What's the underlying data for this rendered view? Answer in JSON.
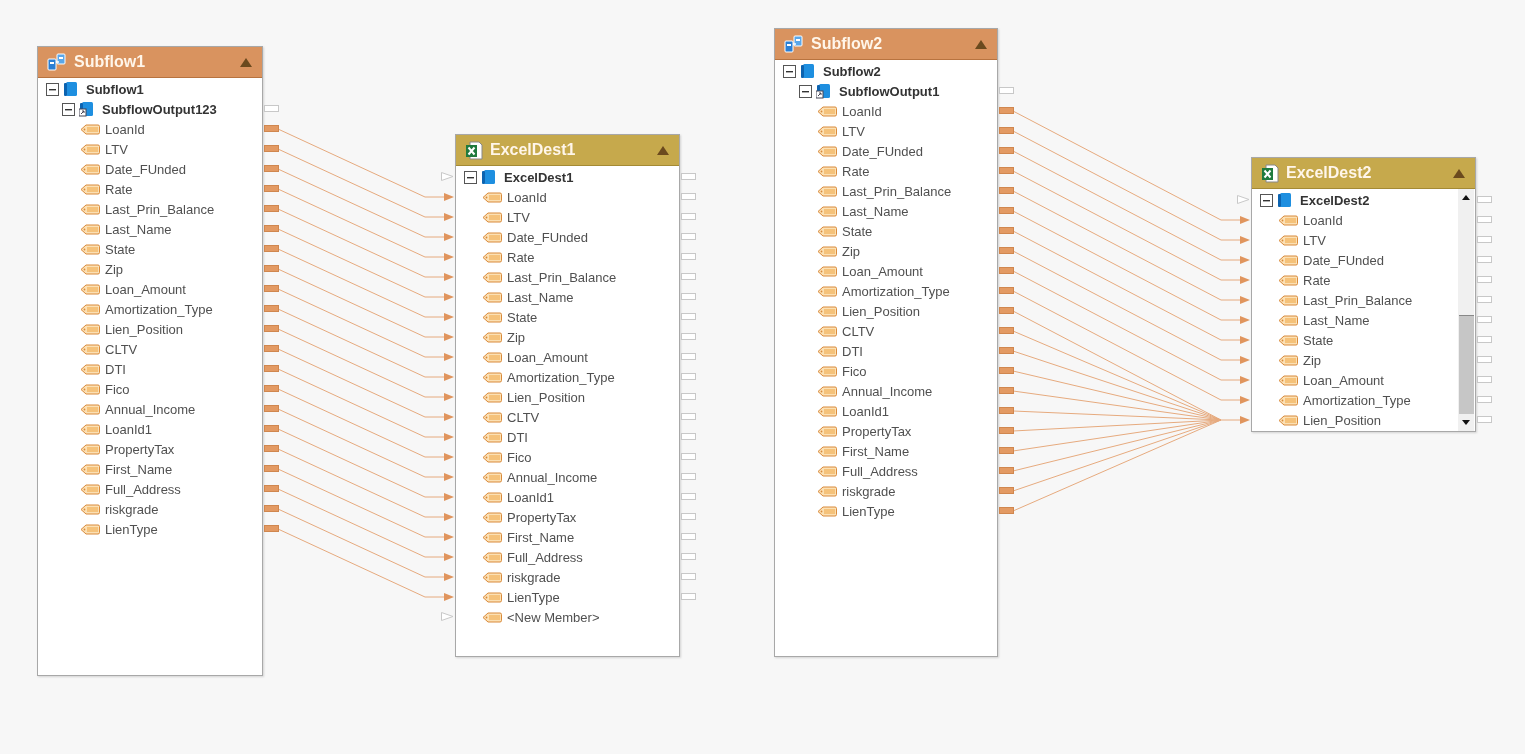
{
  "nodes": [
    {
      "kind": "subflow",
      "title": "Subflow1",
      "root": {
        "label": "Subflow1",
        "expanded": true
      },
      "output": {
        "label": "SubflowOutput123",
        "expanded": true
      },
      "fields": [
        {
          "label": "LoanId",
          "connected": true
        },
        {
          "label": "LTV",
          "connected": true
        },
        {
          "label": "Date_FUnded",
          "connected": true
        },
        {
          "label": "Rate",
          "connected": true
        },
        {
          "label": "Last_Prin_Balance",
          "connected": true
        },
        {
          "label": "Last_Name",
          "connected": true
        },
        {
          "label": "State",
          "connected": true
        },
        {
          "label": "Zip",
          "connected": true
        },
        {
          "label": "Loan_Amount",
          "connected": true
        },
        {
          "label": "Amortization_Type",
          "connected": true
        },
        {
          "label": "Lien_Position",
          "connected": true
        },
        {
          "label": "CLTV",
          "connected": true
        },
        {
          "label": "DTI",
          "connected": true
        },
        {
          "label": "Fico",
          "connected": true
        },
        {
          "label": "Annual_Income",
          "connected": true
        },
        {
          "label": "LoanId1",
          "connected": true
        },
        {
          "label": "PropertyTax",
          "connected": true
        },
        {
          "label": "First_Name",
          "connected": true
        },
        {
          "label": "Full_Address",
          "connected": true
        },
        {
          "label": "riskgrade",
          "connected": true
        },
        {
          "label": "LienType",
          "connected": true
        }
      ]
    },
    {
      "kind": "excel",
      "title": "ExcelDest1",
      "root": {
        "label": "ExcelDest1",
        "expanded": true
      },
      "fields": [
        {
          "label": "LoanId"
        },
        {
          "label": "LTV"
        },
        {
          "label": "Date_FUnded"
        },
        {
          "label": "Rate"
        },
        {
          "label": "Last_Prin_Balance"
        },
        {
          "label": "Last_Name"
        },
        {
          "label": "State"
        },
        {
          "label": "Zip"
        },
        {
          "label": "Loan_Amount"
        },
        {
          "label": "Amortization_Type"
        },
        {
          "label": "Lien_Position"
        },
        {
          "label": "CLTV"
        },
        {
          "label": "DTI"
        },
        {
          "label": "Fico"
        },
        {
          "label": "Annual_Income"
        },
        {
          "label": "LoanId1"
        },
        {
          "label": "PropertyTax"
        },
        {
          "label": "First_Name"
        },
        {
          "label": "Full_Address"
        },
        {
          "label": "riskgrade"
        },
        {
          "label": "LienType"
        }
      ],
      "new_member": "<New Member>"
    },
    {
      "kind": "subflow",
      "title": "Subflow2",
      "root": {
        "label": "Subflow2",
        "expanded": true
      },
      "output": {
        "label": "SubflowOutput1",
        "expanded": true
      },
      "fields": [
        {
          "label": "LoanId",
          "connected": true
        },
        {
          "label": "LTV",
          "connected": true
        },
        {
          "label": "Date_FUnded",
          "connected": true
        },
        {
          "label": "Rate",
          "connected": true
        },
        {
          "label": "Last_Prin_Balance",
          "connected": true
        },
        {
          "label": "Last_Name",
          "connected": true
        },
        {
          "label": "State",
          "connected": true
        },
        {
          "label": "Zip",
          "connected": true
        },
        {
          "label": "Loan_Amount",
          "connected": true
        },
        {
          "label": "Amortization_Type",
          "connected": true
        },
        {
          "label": "Lien_Position",
          "connected": true
        },
        {
          "label": "CLTV",
          "connected": true
        },
        {
          "label": "DTI",
          "connected": true
        },
        {
          "label": "Fico",
          "connected": true
        },
        {
          "label": "Annual_Income",
          "connected": true
        },
        {
          "label": "LoanId1",
          "connected": true
        },
        {
          "label": "PropertyTax",
          "connected": true
        },
        {
          "label": "First_Name",
          "connected": true
        },
        {
          "label": "Full_Address",
          "connected": true
        },
        {
          "label": "riskgrade",
          "connected": true
        },
        {
          "label": "LienType",
          "connected": true
        }
      ]
    },
    {
      "kind": "excel",
      "title": "ExcelDest2",
      "root": {
        "label": "ExcelDest2",
        "expanded": true
      },
      "fields": [
        {
          "label": "LoanId"
        },
        {
          "label": "LTV"
        },
        {
          "label": "Date_FUnded"
        },
        {
          "label": "Rate"
        },
        {
          "label": "Last_Prin_Balance"
        },
        {
          "label": "Last_Name"
        },
        {
          "label": "State"
        },
        {
          "label": "Zip"
        },
        {
          "label": "Loan_Amount"
        },
        {
          "label": "Amortization_Type"
        },
        {
          "label": "Lien_Position"
        }
      ]
    }
  ]
}
